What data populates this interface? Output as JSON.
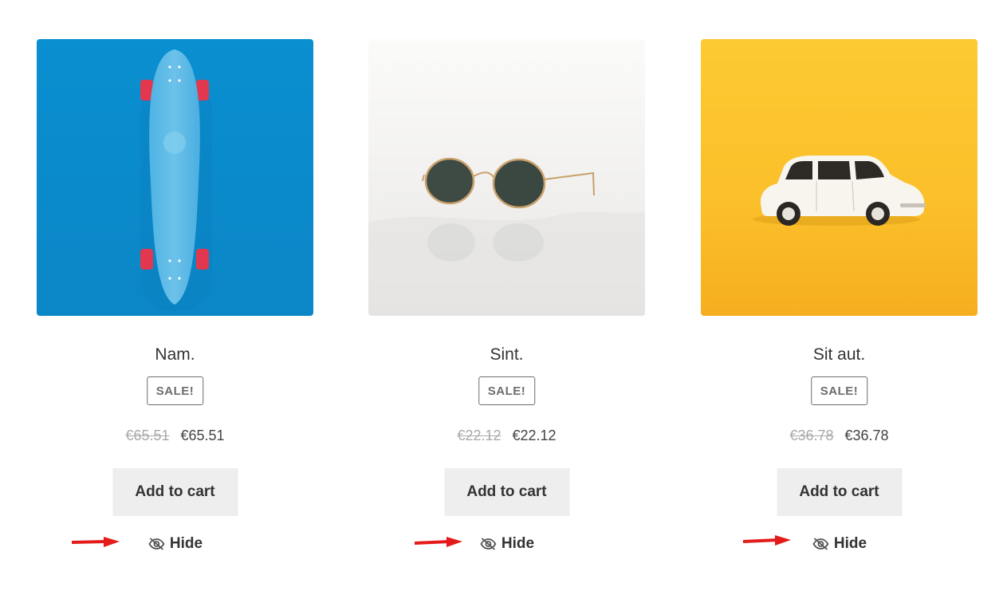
{
  "products": [
    {
      "name": "Nam.",
      "badge": "SALE!",
      "old_price": "€65.51",
      "new_price": "€65.51",
      "cart_label": "Add to cart",
      "hide_label": "Hide",
      "image_icon": "skateboard-image",
      "bg_color": "#0b8fcf"
    },
    {
      "name": "Sint.",
      "badge": "SALE!",
      "old_price": "€22.12",
      "new_price": "€22.12",
      "cart_label": "Add to cart",
      "hide_label": "Hide",
      "image_icon": "sunglasses-image",
      "bg_color": "#f4f3f2"
    },
    {
      "name": "Sit aut.",
      "badge": "SALE!",
      "old_price": "€36.78",
      "new_price": "€36.78",
      "cart_label": "Add to cart",
      "hide_label": "Hide",
      "image_icon": "toy-car-image",
      "bg_color": "#fbc02d"
    }
  ],
  "colors": {
    "annotation_arrow": "#e31b1b",
    "button_bg": "#eeeeee",
    "badge_border": "#6d6d6d"
  }
}
